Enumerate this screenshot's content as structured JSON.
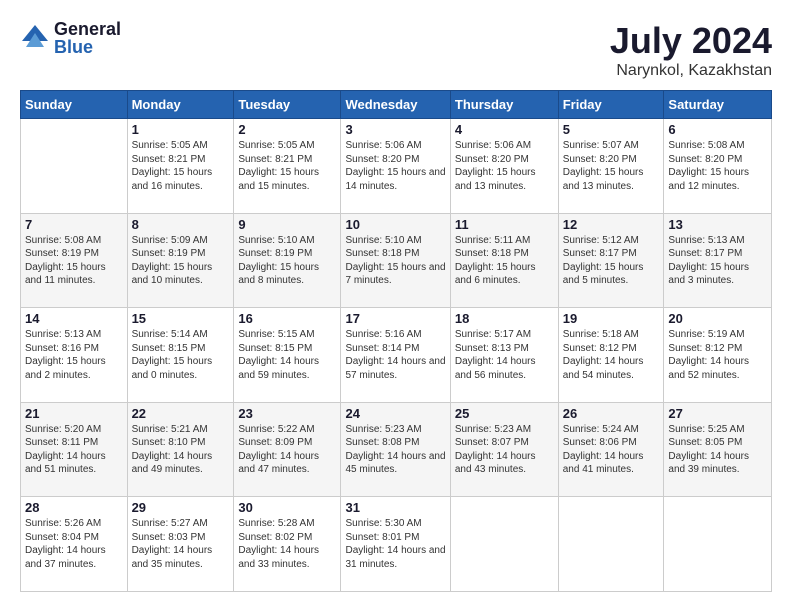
{
  "logo": {
    "general": "General",
    "blue": "Blue"
  },
  "header": {
    "month": "July 2024",
    "location": "Narynkol, Kazakhstan"
  },
  "weekdays": [
    "Sunday",
    "Monday",
    "Tuesday",
    "Wednesday",
    "Thursday",
    "Friday",
    "Saturday"
  ],
  "weeks": [
    [
      {
        "day": "",
        "sunrise": "",
        "sunset": "",
        "daylight": ""
      },
      {
        "day": "1",
        "sunrise": "Sunrise: 5:05 AM",
        "sunset": "Sunset: 8:21 PM",
        "daylight": "Daylight: 15 hours and 16 minutes."
      },
      {
        "day": "2",
        "sunrise": "Sunrise: 5:05 AM",
        "sunset": "Sunset: 8:21 PM",
        "daylight": "Daylight: 15 hours and 15 minutes."
      },
      {
        "day": "3",
        "sunrise": "Sunrise: 5:06 AM",
        "sunset": "Sunset: 8:20 PM",
        "daylight": "Daylight: 15 hours and 14 minutes."
      },
      {
        "day": "4",
        "sunrise": "Sunrise: 5:06 AM",
        "sunset": "Sunset: 8:20 PM",
        "daylight": "Daylight: 15 hours and 13 minutes."
      },
      {
        "day": "5",
        "sunrise": "Sunrise: 5:07 AM",
        "sunset": "Sunset: 8:20 PM",
        "daylight": "Daylight: 15 hours and 13 minutes."
      },
      {
        "day": "6",
        "sunrise": "Sunrise: 5:08 AM",
        "sunset": "Sunset: 8:20 PM",
        "daylight": "Daylight: 15 hours and 12 minutes."
      }
    ],
    [
      {
        "day": "7",
        "sunrise": "Sunrise: 5:08 AM",
        "sunset": "Sunset: 8:19 PM",
        "daylight": "Daylight: 15 hours and 11 minutes."
      },
      {
        "day": "8",
        "sunrise": "Sunrise: 5:09 AM",
        "sunset": "Sunset: 8:19 PM",
        "daylight": "Daylight: 15 hours and 10 minutes."
      },
      {
        "day": "9",
        "sunrise": "Sunrise: 5:10 AM",
        "sunset": "Sunset: 8:19 PM",
        "daylight": "Daylight: 15 hours and 8 minutes."
      },
      {
        "day": "10",
        "sunrise": "Sunrise: 5:10 AM",
        "sunset": "Sunset: 8:18 PM",
        "daylight": "Daylight: 15 hours and 7 minutes."
      },
      {
        "day": "11",
        "sunrise": "Sunrise: 5:11 AM",
        "sunset": "Sunset: 8:18 PM",
        "daylight": "Daylight: 15 hours and 6 minutes."
      },
      {
        "day": "12",
        "sunrise": "Sunrise: 5:12 AM",
        "sunset": "Sunset: 8:17 PM",
        "daylight": "Daylight: 15 hours and 5 minutes."
      },
      {
        "day": "13",
        "sunrise": "Sunrise: 5:13 AM",
        "sunset": "Sunset: 8:17 PM",
        "daylight": "Daylight: 15 hours and 3 minutes."
      }
    ],
    [
      {
        "day": "14",
        "sunrise": "Sunrise: 5:13 AM",
        "sunset": "Sunset: 8:16 PM",
        "daylight": "Daylight: 15 hours and 2 minutes."
      },
      {
        "day": "15",
        "sunrise": "Sunrise: 5:14 AM",
        "sunset": "Sunset: 8:15 PM",
        "daylight": "Daylight: 15 hours and 0 minutes."
      },
      {
        "day": "16",
        "sunrise": "Sunrise: 5:15 AM",
        "sunset": "Sunset: 8:15 PM",
        "daylight": "Daylight: 14 hours and 59 minutes."
      },
      {
        "day": "17",
        "sunrise": "Sunrise: 5:16 AM",
        "sunset": "Sunset: 8:14 PM",
        "daylight": "Daylight: 14 hours and 57 minutes."
      },
      {
        "day": "18",
        "sunrise": "Sunrise: 5:17 AM",
        "sunset": "Sunset: 8:13 PM",
        "daylight": "Daylight: 14 hours and 56 minutes."
      },
      {
        "day": "19",
        "sunrise": "Sunrise: 5:18 AM",
        "sunset": "Sunset: 8:12 PM",
        "daylight": "Daylight: 14 hours and 54 minutes."
      },
      {
        "day": "20",
        "sunrise": "Sunrise: 5:19 AM",
        "sunset": "Sunset: 8:12 PM",
        "daylight": "Daylight: 14 hours and 52 minutes."
      }
    ],
    [
      {
        "day": "21",
        "sunrise": "Sunrise: 5:20 AM",
        "sunset": "Sunset: 8:11 PM",
        "daylight": "Daylight: 14 hours and 51 minutes."
      },
      {
        "day": "22",
        "sunrise": "Sunrise: 5:21 AM",
        "sunset": "Sunset: 8:10 PM",
        "daylight": "Daylight: 14 hours and 49 minutes."
      },
      {
        "day": "23",
        "sunrise": "Sunrise: 5:22 AM",
        "sunset": "Sunset: 8:09 PM",
        "daylight": "Daylight: 14 hours and 47 minutes."
      },
      {
        "day": "24",
        "sunrise": "Sunrise: 5:23 AM",
        "sunset": "Sunset: 8:08 PM",
        "daylight": "Daylight: 14 hours and 45 minutes."
      },
      {
        "day": "25",
        "sunrise": "Sunrise: 5:23 AM",
        "sunset": "Sunset: 8:07 PM",
        "daylight": "Daylight: 14 hours and 43 minutes."
      },
      {
        "day": "26",
        "sunrise": "Sunrise: 5:24 AM",
        "sunset": "Sunset: 8:06 PM",
        "daylight": "Daylight: 14 hours and 41 minutes."
      },
      {
        "day": "27",
        "sunrise": "Sunrise: 5:25 AM",
        "sunset": "Sunset: 8:05 PM",
        "daylight": "Daylight: 14 hours and 39 minutes."
      }
    ],
    [
      {
        "day": "28",
        "sunrise": "Sunrise: 5:26 AM",
        "sunset": "Sunset: 8:04 PM",
        "daylight": "Daylight: 14 hours and 37 minutes."
      },
      {
        "day": "29",
        "sunrise": "Sunrise: 5:27 AM",
        "sunset": "Sunset: 8:03 PM",
        "daylight": "Daylight: 14 hours and 35 minutes."
      },
      {
        "day": "30",
        "sunrise": "Sunrise: 5:28 AM",
        "sunset": "Sunset: 8:02 PM",
        "daylight": "Daylight: 14 hours and 33 minutes."
      },
      {
        "day": "31",
        "sunrise": "Sunrise: 5:30 AM",
        "sunset": "Sunset: 8:01 PM",
        "daylight": "Daylight: 14 hours and 31 minutes."
      },
      {
        "day": "",
        "sunrise": "",
        "sunset": "",
        "daylight": ""
      },
      {
        "day": "",
        "sunrise": "",
        "sunset": "",
        "daylight": ""
      },
      {
        "day": "",
        "sunrise": "",
        "sunset": "",
        "daylight": ""
      }
    ]
  ]
}
